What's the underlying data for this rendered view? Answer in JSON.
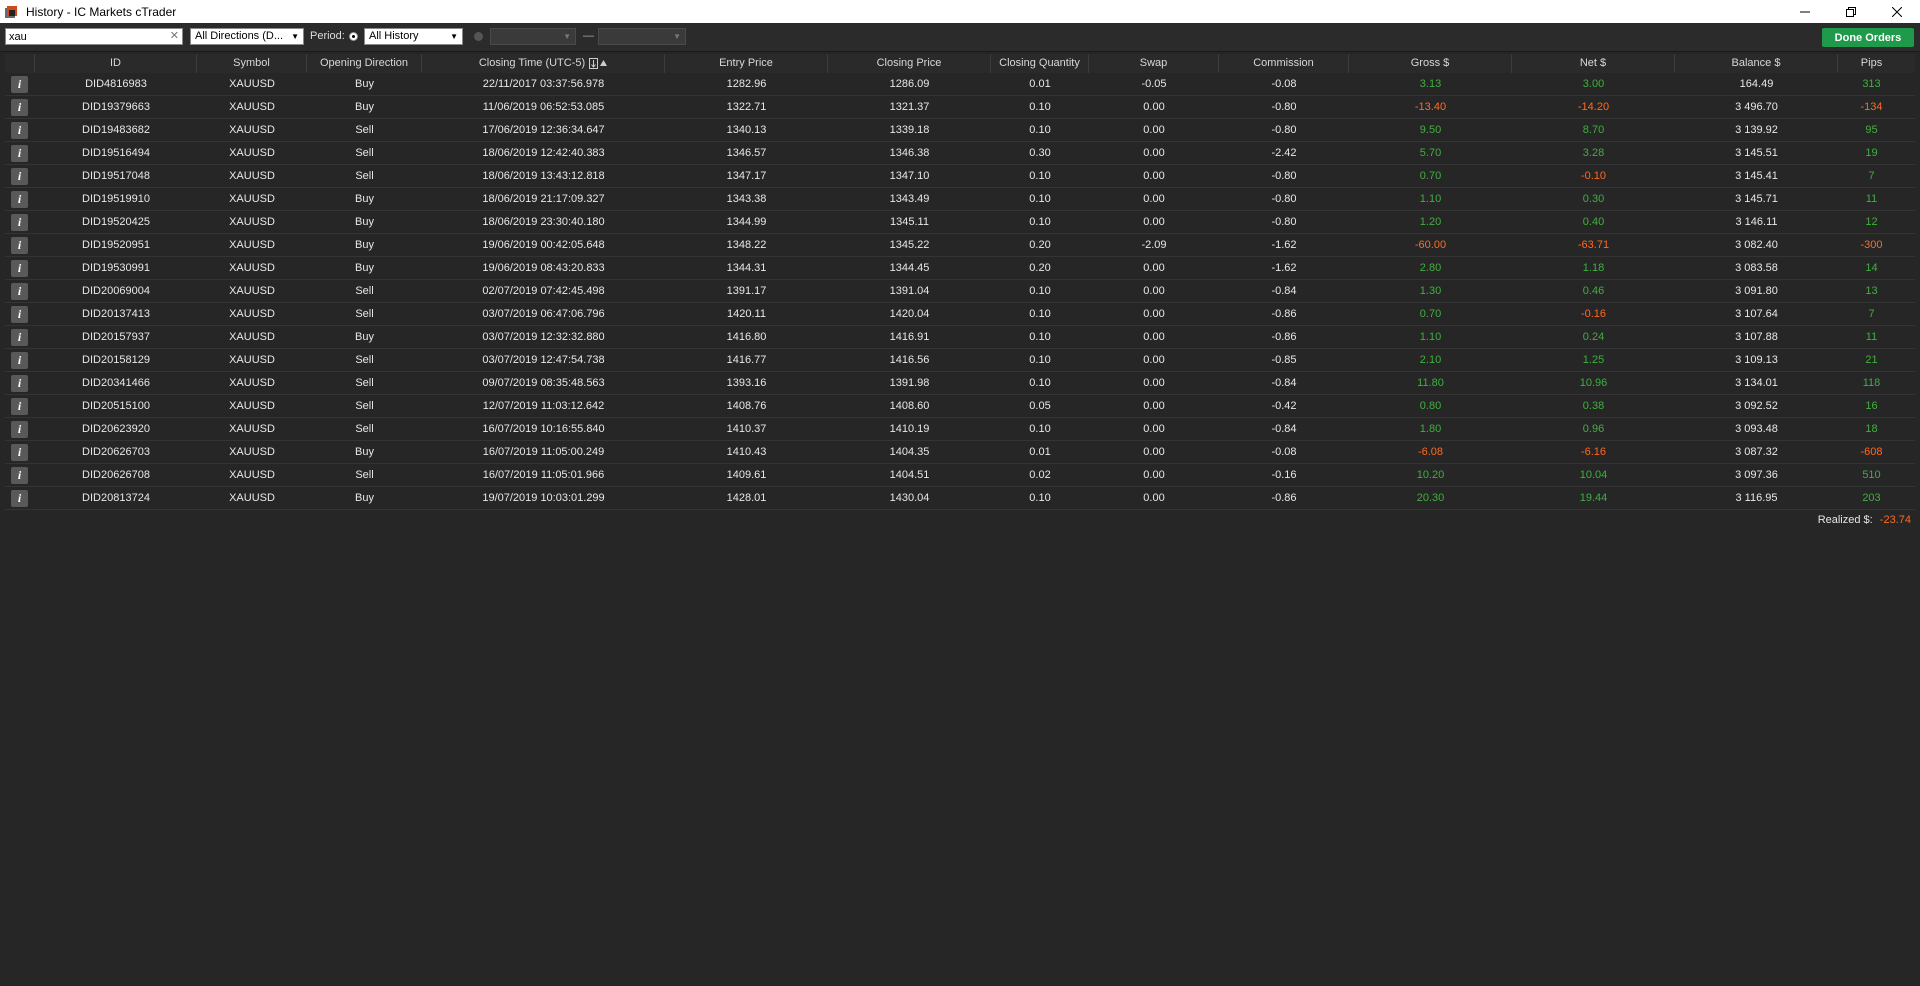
{
  "window": {
    "title": "History - IC Markets cTrader",
    "controls": [
      "minimize",
      "restore",
      "close"
    ]
  },
  "toolbar": {
    "search_value": "xau",
    "direction_filter": "All Directions (D...",
    "period_label": "Period:",
    "period_value": "All History",
    "done_orders_label": "Done Orders"
  },
  "columns": [
    "ID",
    "Symbol",
    "Opening Direction",
    "Closing Time (UTC-5)",
    "Entry Price",
    "Closing Price",
    "Closing Quantity",
    "Swap",
    "Commission",
    "Gross $",
    "Net $",
    "Balance $",
    "Pips"
  ],
  "rows": [
    {
      "id": "DID4816983",
      "symbol": "XAUUSD",
      "dir": "Buy",
      "time": "22/11/2017 03:37:56.978",
      "entry": "1282.96",
      "close": "1286.09",
      "qty": "0.01",
      "swap": "-0.05",
      "comm": "-0.08",
      "gross": "3.13",
      "net": "3.00",
      "balance": "164.49",
      "pips": "313"
    },
    {
      "id": "DID19379663",
      "symbol": "XAUUSD",
      "dir": "Buy",
      "time": "11/06/2019 06:52:53.085",
      "entry": "1322.71",
      "close": "1321.37",
      "qty": "0.10",
      "swap": "0.00",
      "comm": "-0.80",
      "gross": "-13.40",
      "net": "-14.20",
      "balance": "3 496.70",
      "pips": "-134"
    },
    {
      "id": "DID19483682",
      "symbol": "XAUUSD",
      "dir": "Sell",
      "time": "17/06/2019 12:36:34.647",
      "entry": "1340.13",
      "close": "1339.18",
      "qty": "0.10",
      "swap": "0.00",
      "comm": "-0.80",
      "gross": "9.50",
      "net": "8.70",
      "balance": "3 139.92",
      "pips": "95"
    },
    {
      "id": "DID19516494",
      "symbol": "XAUUSD",
      "dir": "Sell",
      "time": "18/06/2019 12:42:40.383",
      "entry": "1346.57",
      "close": "1346.38",
      "qty": "0.30",
      "swap": "0.00",
      "comm": "-2.42",
      "gross": "5.70",
      "net": "3.28",
      "balance": "3 145.51",
      "pips": "19"
    },
    {
      "id": "DID19517048",
      "symbol": "XAUUSD",
      "dir": "Sell",
      "time": "18/06/2019 13:43:12.818",
      "entry": "1347.17",
      "close": "1347.10",
      "qty": "0.10",
      "swap": "0.00",
      "comm": "-0.80",
      "gross": "0.70",
      "net": "-0.10",
      "balance": "3 145.41",
      "pips": "7"
    },
    {
      "id": "DID19519910",
      "symbol": "XAUUSD",
      "dir": "Buy",
      "time": "18/06/2019 21:17:09.327",
      "entry": "1343.38",
      "close": "1343.49",
      "qty": "0.10",
      "swap": "0.00",
      "comm": "-0.80",
      "gross": "1.10",
      "net": "0.30",
      "balance": "3 145.71",
      "pips": "11"
    },
    {
      "id": "DID19520425",
      "symbol": "XAUUSD",
      "dir": "Buy",
      "time": "18/06/2019 23:30:40.180",
      "entry": "1344.99",
      "close": "1345.11",
      "qty": "0.10",
      "swap": "0.00",
      "comm": "-0.80",
      "gross": "1.20",
      "net": "0.40",
      "balance": "3 146.11",
      "pips": "12"
    },
    {
      "id": "DID19520951",
      "symbol": "XAUUSD",
      "dir": "Buy",
      "time": "19/06/2019 00:42:05.648",
      "entry": "1348.22",
      "close": "1345.22",
      "qty": "0.20",
      "swap": "-2.09",
      "comm": "-1.62",
      "gross": "-60.00",
      "net": "-63.71",
      "balance": "3 082.40",
      "pips": "-300"
    },
    {
      "id": "DID19530991",
      "symbol": "XAUUSD",
      "dir": "Buy",
      "time": "19/06/2019 08:43:20.833",
      "entry": "1344.31",
      "close": "1344.45",
      "qty": "0.20",
      "swap": "0.00",
      "comm": "-1.62",
      "gross": "2.80",
      "net": "1.18",
      "balance": "3 083.58",
      "pips": "14"
    },
    {
      "id": "DID20069004",
      "symbol": "XAUUSD",
      "dir": "Sell",
      "time": "02/07/2019 07:42:45.498",
      "entry": "1391.17",
      "close": "1391.04",
      "qty": "0.10",
      "swap": "0.00",
      "comm": "-0.84",
      "gross": "1.30",
      "net": "0.46",
      "balance": "3 091.80",
      "pips": "13"
    },
    {
      "id": "DID20137413",
      "symbol": "XAUUSD",
      "dir": "Sell",
      "time": "03/07/2019 06:47:06.796",
      "entry": "1420.11",
      "close": "1420.04",
      "qty": "0.10",
      "swap": "0.00",
      "comm": "-0.86",
      "gross": "0.70",
      "net": "-0.16",
      "balance": "3 107.64",
      "pips": "7"
    },
    {
      "id": "DID20157937",
      "symbol": "XAUUSD",
      "dir": "Buy",
      "time": "03/07/2019 12:32:32.880",
      "entry": "1416.80",
      "close": "1416.91",
      "qty": "0.10",
      "swap": "0.00",
      "comm": "-0.86",
      "gross": "1.10",
      "net": "0.24",
      "balance": "3 107.88",
      "pips": "11"
    },
    {
      "id": "DID20158129",
      "symbol": "XAUUSD",
      "dir": "Sell",
      "time": "03/07/2019 12:47:54.738",
      "entry": "1416.77",
      "close": "1416.56",
      "qty": "0.10",
      "swap": "0.00",
      "comm": "-0.85",
      "gross": "2.10",
      "net": "1.25",
      "balance": "3 109.13",
      "pips": "21"
    },
    {
      "id": "DID20341466",
      "symbol": "XAUUSD",
      "dir": "Sell",
      "time": "09/07/2019 08:35:48.563",
      "entry": "1393.16",
      "close": "1391.98",
      "qty": "0.10",
      "swap": "0.00",
      "comm": "-0.84",
      "gross": "11.80",
      "net": "10.96",
      "balance": "3 134.01",
      "pips": "118"
    },
    {
      "id": "DID20515100",
      "symbol": "XAUUSD",
      "dir": "Sell",
      "time": "12/07/2019 11:03:12.642",
      "entry": "1408.76",
      "close": "1408.60",
      "qty": "0.05",
      "swap": "0.00",
      "comm": "-0.42",
      "gross": "0.80",
      "net": "0.38",
      "balance": "3 092.52",
      "pips": "16"
    },
    {
      "id": "DID20623920",
      "symbol": "XAUUSD",
      "dir": "Sell",
      "time": "16/07/2019 10:16:55.840",
      "entry": "1410.37",
      "close": "1410.19",
      "qty": "0.10",
      "swap": "0.00",
      "comm": "-0.84",
      "gross": "1.80",
      "net": "0.96",
      "balance": "3 093.48",
      "pips": "18"
    },
    {
      "id": "DID20626703",
      "symbol": "XAUUSD",
      "dir": "Buy",
      "time": "16/07/2019 11:05:00.249",
      "entry": "1410.43",
      "close": "1404.35",
      "qty": "0.01",
      "swap": "0.00",
      "comm": "-0.08",
      "gross": "-6.08",
      "net": "-6.16",
      "balance": "3 087.32",
      "pips": "-608"
    },
    {
      "id": "DID20626708",
      "symbol": "XAUUSD",
      "dir": "Sell",
      "time": "16/07/2019 11:05:01.966",
      "entry": "1409.61",
      "close": "1404.51",
      "qty": "0.02",
      "swap": "0.00",
      "comm": "-0.16",
      "gross": "10.20",
      "net": "10.04",
      "balance": "3 097.36",
      "pips": "510"
    },
    {
      "id": "DID20813724",
      "symbol": "XAUUSD",
      "dir": "Buy",
      "time": "19/07/2019 10:03:01.299",
      "entry": "1428.01",
      "close": "1430.04",
      "qty": "0.10",
      "swap": "0.00",
      "comm": "-0.86",
      "gross": "20.30",
      "net": "19.44",
      "balance": "3 116.95",
      "pips": "203"
    }
  ],
  "info_glyph": "i",
  "footer": {
    "realized_label": "Realized $:",
    "realized_value": "-23.74"
  },
  "colors": {
    "positive": "#3fb03f",
    "negative": "#ff6a1f",
    "accent_button": "#1f9a4b"
  }
}
